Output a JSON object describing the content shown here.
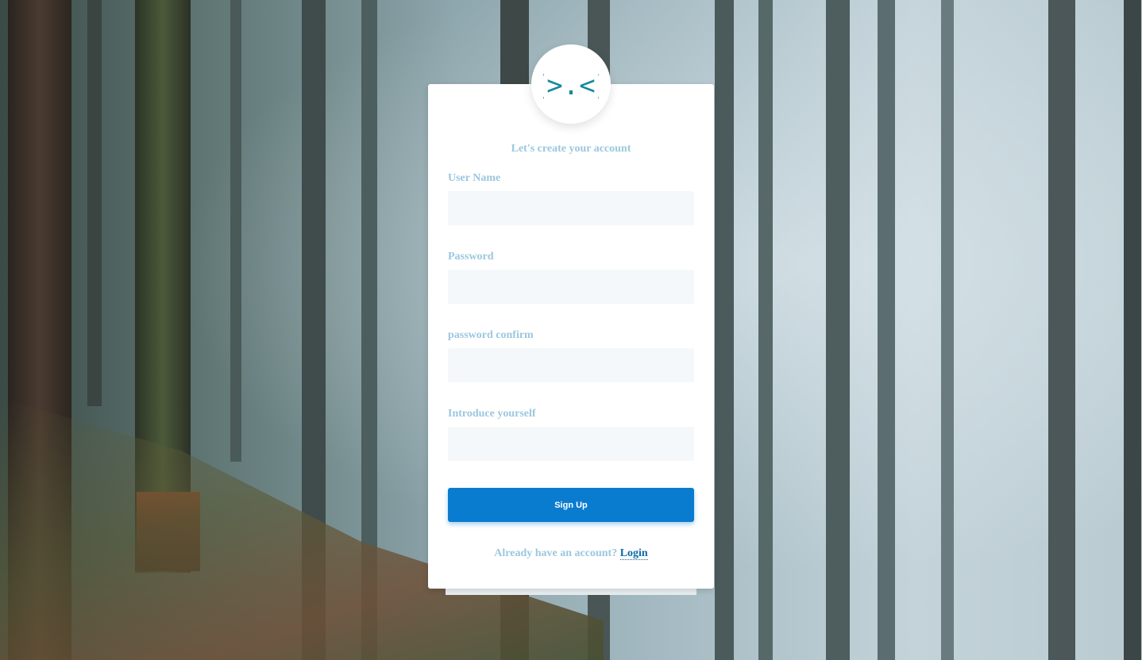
{
  "logo": {
    "glyph": "{>.<}",
    "icon": "code-brackets-icon",
    "color": "#1a8a99"
  },
  "signup": {
    "subtitle": "Let's create your account",
    "fields": [
      {
        "label": "User Name",
        "value": "",
        "placeholder": ""
      },
      {
        "label": "Password",
        "value": "",
        "placeholder": ""
      },
      {
        "label": "password confirm",
        "value": "",
        "placeholder": ""
      },
      {
        "label": "Introduce yourself",
        "value": "",
        "placeholder": ""
      }
    ],
    "submit_label": "Sign Up",
    "footer_prompt": "Already have an account?",
    "login_link": "Login"
  },
  "colors": {
    "label": "#9bc7df",
    "button": "#0a7ccf",
    "link": "#0c6aa8",
    "input_bg": "#f4f8fb"
  }
}
